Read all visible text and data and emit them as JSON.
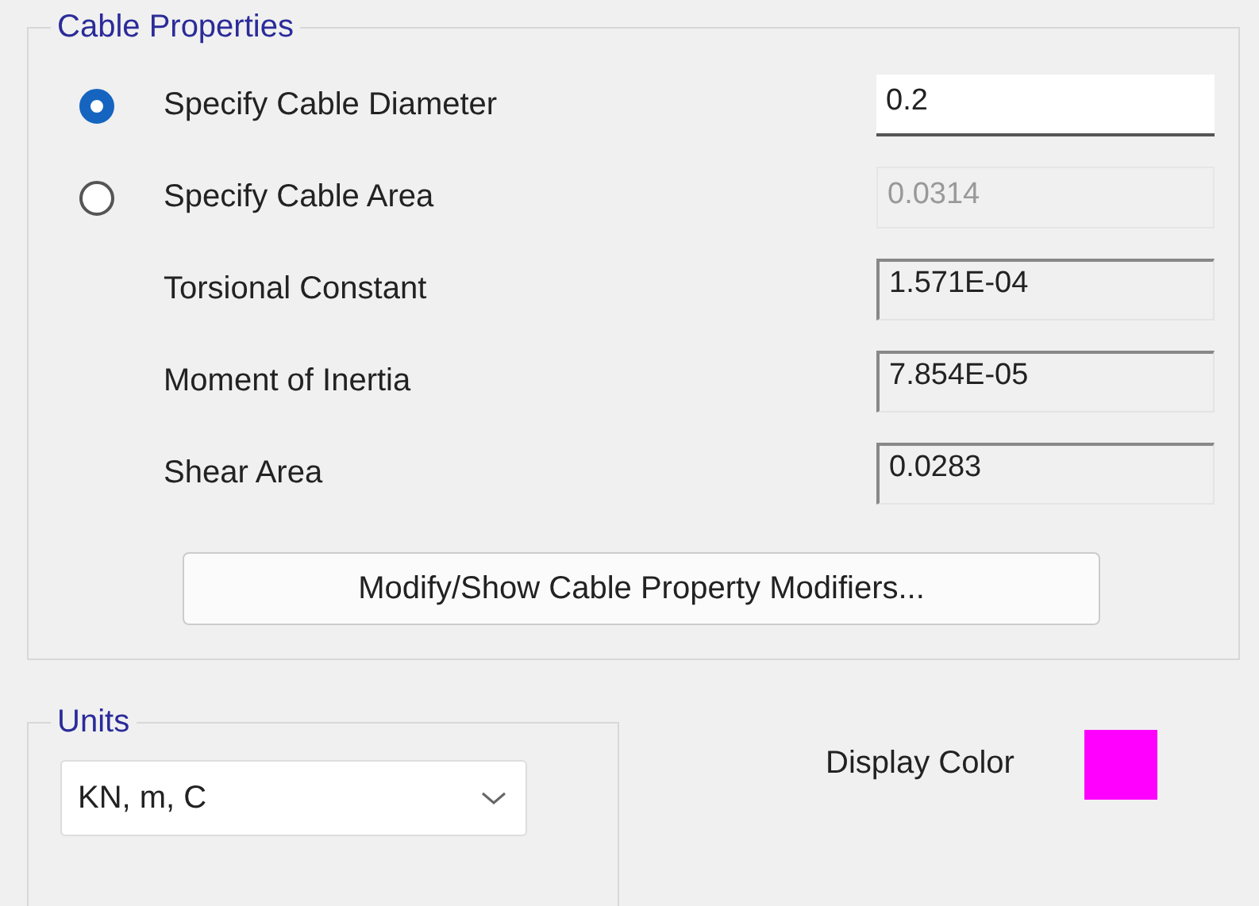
{
  "cable_properties": {
    "title": "Cable Properties",
    "rows": [
      {
        "kind": "radio",
        "label": "Specify Cable Diameter",
        "selected": true,
        "field": {
          "kind": "input",
          "value": "0.2"
        }
      },
      {
        "kind": "radio",
        "label": "Specify Cable Area",
        "selected": false,
        "field": {
          "kind": "disabled",
          "value": "0.0314"
        }
      },
      {
        "kind": "plain",
        "label": "Torsional Constant",
        "field": {
          "kind": "readonly",
          "value": "1.571E-04"
        }
      },
      {
        "kind": "plain",
        "label": "Moment of Inertia",
        "field": {
          "kind": "readonly",
          "value": "7.854E-05"
        }
      },
      {
        "kind": "plain",
        "label": "Shear Area",
        "field": {
          "kind": "readonly",
          "value": "0.0283"
        }
      }
    ],
    "button": "Modify/Show Cable Property Modifiers..."
  },
  "units": {
    "title": "Units",
    "value": "KN, m, C"
  },
  "display_color": {
    "label": "Display Color",
    "color": "#ff00ff"
  }
}
